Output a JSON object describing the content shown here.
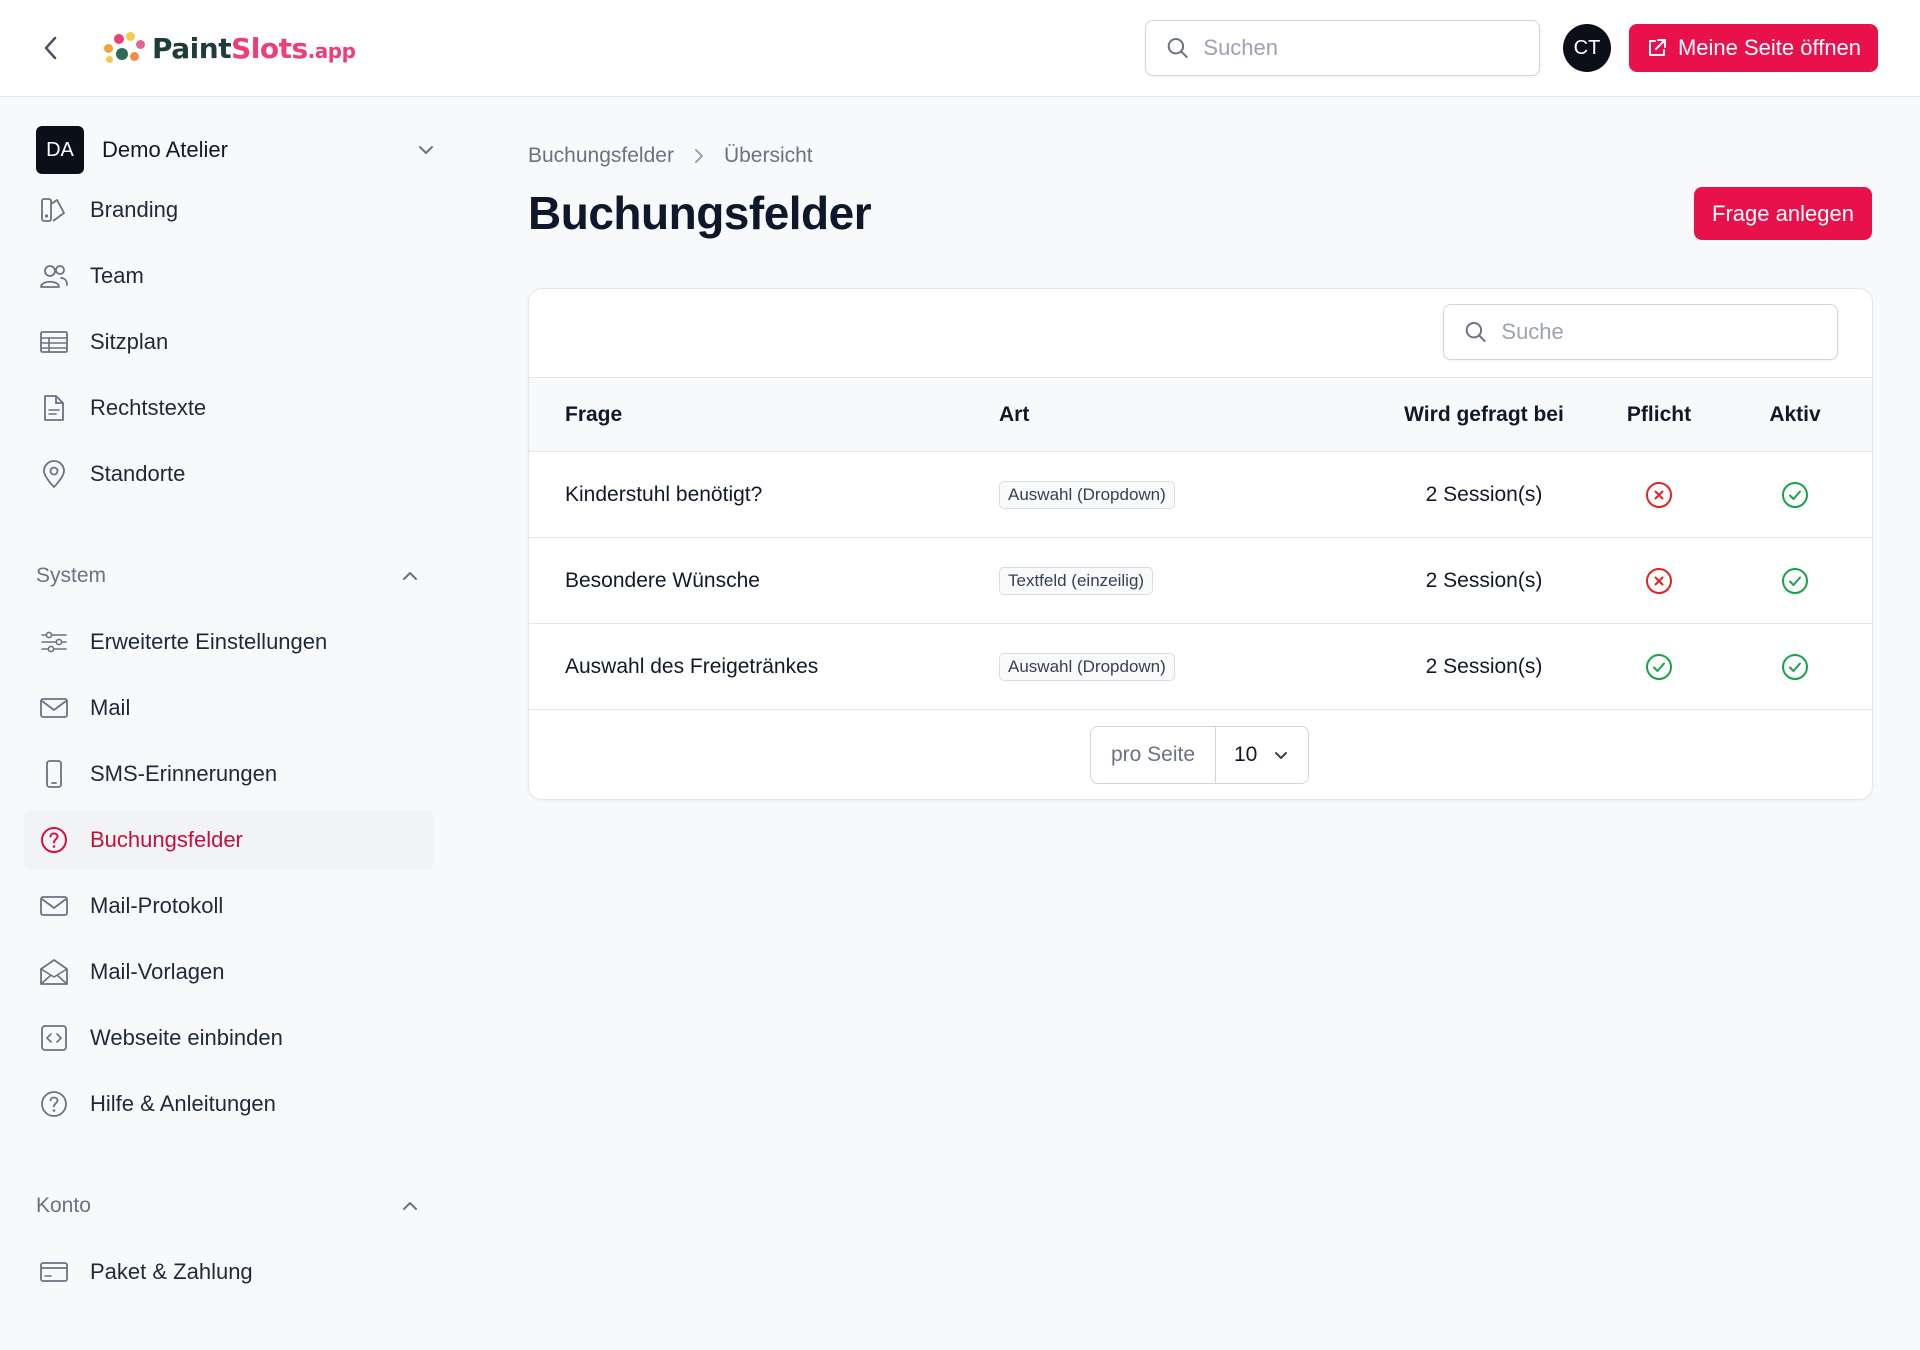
{
  "header": {
    "logo": {
      "name": "PaintSlots",
      "name_part1": "Paint",
      "name_part2": "Slots",
      "tld": ".app"
    },
    "search_placeholder": "Suchen",
    "user_initials": "CT",
    "open_page_label": "Meine Seite öffnen",
    "brand_color": "#e8114b"
  },
  "sidebar": {
    "org": {
      "initials": "DA",
      "name": "Demo Atelier"
    },
    "items": [
      {
        "label": "Branding",
        "icon": "branding-icon"
      },
      {
        "label": "Team",
        "icon": "users-icon"
      },
      {
        "label": "Sitzplan",
        "icon": "table-icon"
      },
      {
        "label": "Rechtstexte",
        "icon": "document-icon"
      },
      {
        "label": "Standorte",
        "icon": "map-pin-icon"
      }
    ],
    "system": {
      "title": "System",
      "items": [
        {
          "label": "Erweiterte Einstellungen",
          "icon": "sliders-icon"
        },
        {
          "label": "Mail",
          "icon": "mail-icon"
        },
        {
          "label": "SMS-Erinnerungen",
          "icon": "phone-icon"
        },
        {
          "label": "Buchungsfelder",
          "icon": "question-icon",
          "active": true
        },
        {
          "label": "Mail-Protokoll",
          "icon": "mail-icon"
        },
        {
          "label": "Mail-Vorlagen",
          "icon": "mail-open-icon"
        },
        {
          "label": "Webseite einbinden",
          "icon": "code-icon"
        },
        {
          "label": "Hilfe & Anleitungen",
          "icon": "help-icon"
        }
      ]
    },
    "konto": {
      "title": "Konto",
      "items": [
        {
          "label": "Paket & Zahlung",
          "icon": "credit-card-icon"
        }
      ]
    }
  },
  "main": {
    "breadcrumb": [
      "Buchungsfelder",
      "Übersicht"
    ],
    "title": "Buchungsfelder",
    "create_label": "Frage anlegen",
    "table": {
      "search_placeholder": "Suche",
      "columns": [
        "Frage",
        "Art",
        "Wird gefragt bei",
        "Pflicht",
        "Aktiv"
      ],
      "rows": [
        {
          "frage": "Kinderstuhl benötigt?",
          "art": "Auswahl (Dropdown)",
          "sessions": "2 Session(s)",
          "pflicht": false,
          "aktiv": true
        },
        {
          "frage": "Besondere Wünsche",
          "art": "Textfeld (einzeilig)",
          "sessions": "2 Session(s)",
          "pflicht": false,
          "aktiv": true
        },
        {
          "frage": "Auswahl des Freigetränkes",
          "art": "Auswahl (Dropdown)",
          "sessions": "2 Session(s)",
          "pflicht": true,
          "aktiv": true
        }
      ],
      "per_page_label": "pro Seite",
      "per_page_value": "10"
    },
    "status_colors": {
      "yes": "#16a34a",
      "no": "#dc2626"
    }
  }
}
